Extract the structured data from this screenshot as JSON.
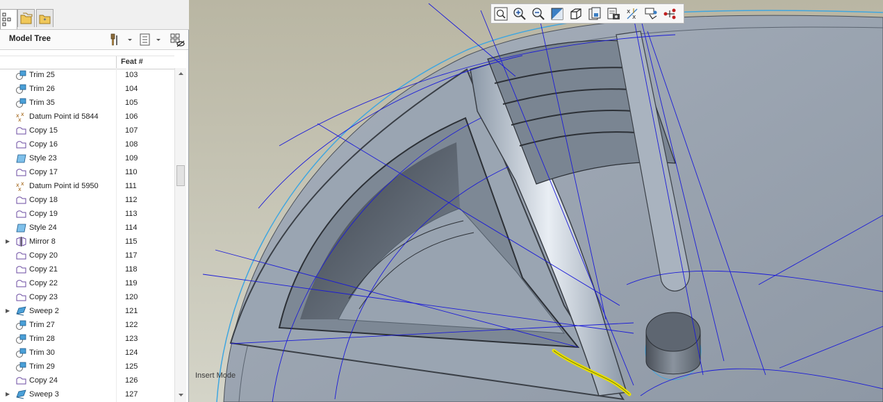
{
  "model_tree": {
    "title": "Model Tree",
    "column_header": "Feat #",
    "rows": [
      {
        "label": "Trim 25",
        "num": "103",
        "icon": "trim-icon",
        "expandable": false
      },
      {
        "label": "Trim 26",
        "num": "104",
        "icon": "trim-icon",
        "expandable": false
      },
      {
        "label": "Trim 35",
        "num": "105",
        "icon": "trim-icon",
        "expandable": false
      },
      {
        "label": "Datum Point id 5844",
        "num": "106",
        "icon": "datum-point-icon",
        "expandable": false
      },
      {
        "label": "Copy 15",
        "num": "107",
        "icon": "copy-icon",
        "expandable": false
      },
      {
        "label": "Copy 16",
        "num": "108",
        "icon": "copy-icon",
        "expandable": false
      },
      {
        "label": "Style 23",
        "num": "109",
        "icon": "style-icon",
        "expandable": false
      },
      {
        "label": "Copy 17",
        "num": "110",
        "icon": "copy-icon",
        "expandable": false
      },
      {
        "label": "Datum Point id 5950",
        "num": "111",
        "icon": "datum-point-icon",
        "expandable": false
      },
      {
        "label": "Copy 18",
        "num": "112",
        "icon": "copy-icon",
        "expandable": false
      },
      {
        "label": "Copy 19",
        "num": "113",
        "icon": "copy-icon",
        "expandable": false
      },
      {
        "label": "Style 24",
        "num": "114",
        "icon": "style-icon",
        "expandable": false
      },
      {
        "label": "Mirror 8",
        "num": "115",
        "icon": "mirror-icon",
        "expandable": true
      },
      {
        "label": "Copy 20",
        "num": "117",
        "icon": "copy-icon",
        "expandable": false
      },
      {
        "label": "Copy 21",
        "num": "118",
        "icon": "copy-icon",
        "expandable": false
      },
      {
        "label": "Copy 22",
        "num": "119",
        "icon": "copy-icon",
        "expandable": false
      },
      {
        "label": "Copy 23",
        "num": "120",
        "icon": "copy-icon",
        "expandable": false
      },
      {
        "label": "Sweep 2",
        "num": "121",
        "icon": "sweep-icon",
        "expandable": true
      },
      {
        "label": "Trim 27",
        "num": "122",
        "icon": "trim-icon",
        "expandable": false
      },
      {
        "label": "Trim 28",
        "num": "123",
        "icon": "trim-icon",
        "expandable": false
      },
      {
        "label": "Trim 30",
        "num": "124",
        "icon": "trim-icon",
        "expandable": false
      },
      {
        "label": "Trim 29",
        "num": "125",
        "icon": "trim-icon",
        "expandable": false
      },
      {
        "label": "Copy 24",
        "num": "126",
        "icon": "copy-icon",
        "expandable": false
      },
      {
        "label": "Sweep 3",
        "num": "127",
        "icon": "sweep-icon",
        "expandable": true
      }
    ]
  },
  "graphics_toolbar": {
    "buttons": [
      "refit-icon",
      "zoom-in-icon",
      "zoom-out-icon",
      "repaint-icon",
      "view-orientation-icon",
      "saved-views-icon",
      "display-style-icon",
      "datum-display-icon",
      "annotation-display-icon",
      "spin-center-icon"
    ]
  },
  "viewport": {
    "mode_label": "Insert Mode"
  },
  "colors": {
    "background_light": "#c9c9b8",
    "surface": "#a8b3bf",
    "curve_blue": "#1a1ad8",
    "curve_cyan": "#3fa6e0",
    "highlight_yellow": "#e8e000"
  }
}
